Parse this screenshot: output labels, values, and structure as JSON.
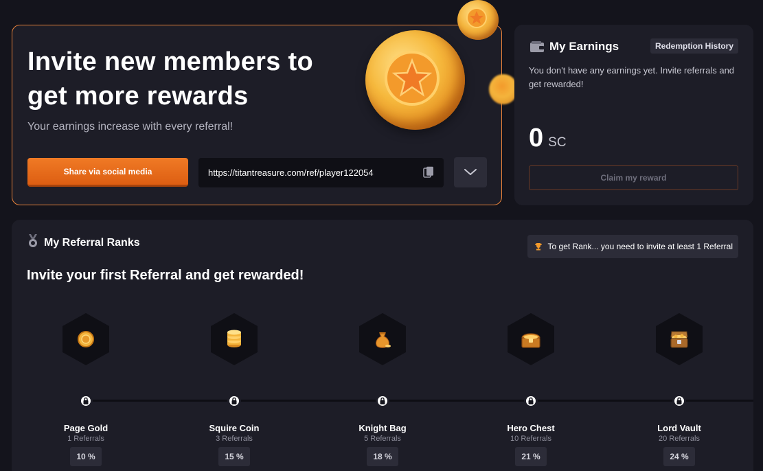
{
  "invite": {
    "title": "Invite new members to get more rewards",
    "subtitle": "Your earnings increase with every referral!",
    "share_label": "Share via social media",
    "referral_link": "https://titantreasure.com/ref/player122054"
  },
  "earnings": {
    "title": "My Earnings",
    "history_label": "Redemption History",
    "message": "You don't have any earnings yet. Invite referrals and get rewarded!",
    "amount": "0",
    "currency": "SC",
    "claim_label": "Claim my reward"
  },
  "ranks": {
    "title": "My Referral Ranks",
    "hint": "To get Rank... you need to invite at least 1 Referral",
    "headline": "Invite your first Referral and get rewarded!",
    "items": [
      {
        "name": "Page Gold",
        "referrals": "1 Referrals",
        "percent": "10 %",
        "icon": "gold-coin-icon"
      },
      {
        "name": "Squire Coin",
        "referrals": "3 Referrals",
        "percent": "15 %",
        "icon": "coin-stack-icon"
      },
      {
        "name": "Knight Bag",
        "referrals": "5 Referrals",
        "percent": "18 %",
        "icon": "money-bag-icon"
      },
      {
        "name": "Hero Chest",
        "referrals": "10 Referrals",
        "percent": "21 %",
        "icon": "treasure-chest-icon"
      },
      {
        "name": "Lord Vault",
        "referrals": "20 Referrals",
        "percent": "24 %",
        "icon": "open-vault-chest-icon"
      }
    ]
  },
  "colors": {
    "accent": "#f07a25",
    "background": "#14141c",
    "card": "#1d1d27",
    "chip": "#2c2c38",
    "gold": "#f4b43c"
  }
}
